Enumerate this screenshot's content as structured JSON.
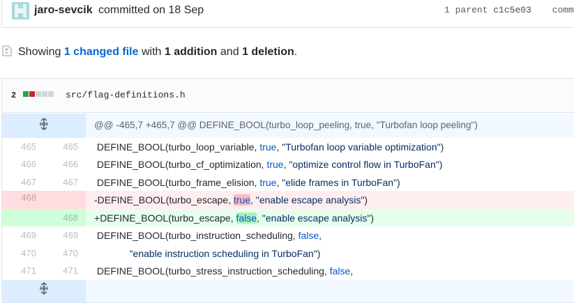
{
  "commit": {
    "author": "jaro-sevcik",
    "date_text": "committed on 18 Sep",
    "parent_label": "1 parent",
    "parent_sha": "c1c5e03",
    "commit_label_partial": "comm"
  },
  "summary": {
    "prefix": "Showing",
    "changed_files": "1 changed file",
    "with": "with",
    "additions": "1 addition",
    "and": "and",
    "deletions": "1 deletion",
    "period": "."
  },
  "file": {
    "change_count": "2",
    "diffstat": [
      "added",
      "deleted",
      "neutral",
      "neutral",
      "neutral"
    ],
    "path": "src/flag-definitions.h"
  },
  "colors": {
    "added": "#28a745",
    "deleted": "#cb2431",
    "neutral": "#d1d5da",
    "hunk_bg": "#f1f8ff",
    "hunk_gutter": "#dbedff",
    "del_bg": "#ffeef0",
    "del_gutter": "#ffdce0",
    "add_bg": "#e6ffed",
    "add_gutter": "#cdffd8"
  },
  "hunk_header": "@@ -465,7 +465,7 @@ DEFINE_BOOL(turbo_loop_peeling, true, \"Turbofan loop peeling\")",
  "lines": [
    {
      "type": "context",
      "old": "465",
      "new": "465",
      "prefix": " ",
      "fn": "DEFINE_BOOL(turbo_loop_variable, ",
      "kw": "true",
      "sep": ", ",
      "str": "\"Turbofan loop variable optimization\"",
      "end": ")"
    },
    {
      "type": "context",
      "old": "466",
      "new": "466",
      "prefix": " ",
      "fn": "DEFINE_BOOL(turbo_cf_optimization, ",
      "kw": "true",
      "sep": ", ",
      "str": "\"optimize control flow in TurboFan\"",
      "end": ")"
    },
    {
      "type": "context",
      "old": "467",
      "new": "467",
      "prefix": " ",
      "fn": "DEFINE_BOOL(turbo_frame_elision, ",
      "kw": "true",
      "sep": ", ",
      "str": "\"elide frames in TurboFan\"",
      "end": ")"
    },
    {
      "type": "deletion",
      "old": "468",
      "new": "",
      "prefix": "-",
      "fn": "DEFINE_BOOL(turbo_escape, ",
      "kw": "true",
      "sep": ", ",
      "str": "\"enable escape analysis\"",
      "end": ")"
    },
    {
      "type": "addition",
      "old": "",
      "new": "468",
      "prefix": "+",
      "fn": "DEFINE_BOOL(turbo_escape, ",
      "kw": "false",
      "sep": ", ",
      "str": "\"enable escape analysis\"",
      "end": ")"
    },
    {
      "type": "context",
      "old": "469",
      "new": "469",
      "prefix": " ",
      "fn": "DEFINE_BOOL(turbo_instruction_scheduling, ",
      "kw": "false",
      "sep": ",",
      "str": "",
      "end": ""
    },
    {
      "type": "context",
      "old": "470",
      "new": "470",
      "prefix": " ",
      "fn": "            ",
      "kw": "",
      "sep": "",
      "str": "\"enable instruction scheduling in TurboFan\"",
      "end": ")"
    },
    {
      "type": "context",
      "old": "471",
      "new": "471",
      "prefix": " ",
      "fn": "DEFINE_BOOL(turbo_stress_instruction_scheduling, ",
      "kw": "false",
      "sep": ",",
      "str": "",
      "end": ""
    }
  ],
  "icons": {
    "avatar": "identicon",
    "summary_icon": "file-diff-icon",
    "expand": "unfold-icon"
  }
}
